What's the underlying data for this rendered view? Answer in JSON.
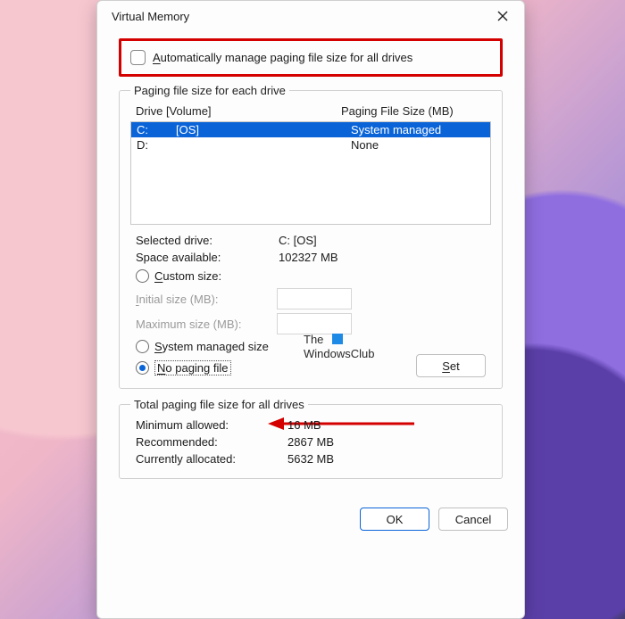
{
  "titlebar": {
    "title": "Virtual Memory"
  },
  "auto_manage": {
    "checked": false,
    "label_pre": "A",
    "label_rest": "utomatically manage paging file size for all drives"
  },
  "group1": {
    "legend": "Paging file size for each drive",
    "header_drive": "Drive  [Volume]",
    "header_size": "Paging File Size (MB)",
    "rows": [
      {
        "drive": "C:",
        "volume": "[OS]",
        "size": "System managed",
        "selected": true
      },
      {
        "drive": "D:",
        "volume": "",
        "size": "None",
        "selected": false
      }
    ],
    "selected_drive_label": "Selected drive:",
    "selected_drive_value": "C:  [OS]",
    "space_label": "Space available:",
    "space_value": "102327 MB",
    "custom_pre": "C",
    "custom_rest": "ustom size:",
    "initial_pre": "I",
    "initial_rest": "nitial size (MB):",
    "max_label": "Maximum size (MB):",
    "sys_pre": "S",
    "sys_rest": "ystem managed size",
    "nopf_pre": "N",
    "nopf_rest": "o paging file",
    "set_pre": "S",
    "set_rest": "et"
  },
  "totals": {
    "legend": "Total paging file size for all drives",
    "min_label": "Minimum allowed:",
    "min_value": "16 MB",
    "rec_label": "Recommended:",
    "rec_value": "2867 MB",
    "cur_label": "Currently allocated:",
    "cur_value": "5632 MB"
  },
  "watermark": {
    "line1": "The",
    "line2": "WindowsClub"
  },
  "footer": {
    "ok": "OK",
    "cancel": "Cancel"
  }
}
